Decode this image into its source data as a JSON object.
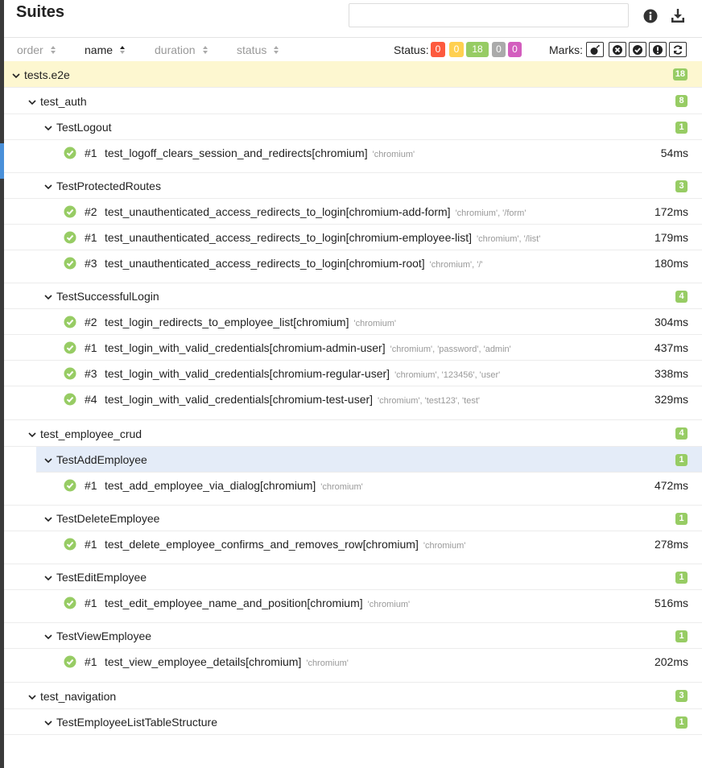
{
  "header": {
    "title": "Suites",
    "search_value": "",
    "search_placeholder": "",
    "info_icon": "info-circle-icon",
    "download_icon": "download-icon"
  },
  "sortbar": {
    "columns": [
      "order",
      "name",
      "duration",
      "status"
    ],
    "active_column": "name",
    "status_label": "Status:",
    "status_counts": [
      {
        "label": "0",
        "color": "#fd5a3e"
      },
      {
        "label": "0",
        "color": "#ffd050"
      },
      {
        "label": "18",
        "color": "#97cc64"
      },
      {
        "label": "0",
        "color": "#aaaaaa"
      },
      {
        "label": "0",
        "color": "#d35ebe"
      }
    ],
    "marks_label": "Marks:",
    "marks": [
      "bomb-icon",
      "times-circle-icon",
      "check-circle-icon",
      "exclamation-circle-icon",
      "refresh-icon"
    ]
  },
  "tree": {
    "root": {
      "name": "tests.e2e",
      "count": "18"
    },
    "modules": [
      {
        "name": "test_auth",
        "count": "8",
        "classes": [
          {
            "name": "TestLogout",
            "count": "1",
            "tests": [
              {
                "order": "#1",
                "name": "test_logoff_clears_session_and_redirects[chromium]",
                "params": "'chromium'",
                "duration": "54ms"
              }
            ]
          },
          {
            "name": "TestProtectedRoutes",
            "count": "3",
            "tests": [
              {
                "order": "#2",
                "name": "test_unauthenticated_access_redirects_to_login[chromium-add-form]",
                "params": "'chromium', '/form'",
                "duration": "172ms"
              },
              {
                "order": "#1",
                "name": "test_unauthenticated_access_redirects_to_login[chromium-employee-list]",
                "params": "'chromium', '/list'",
                "duration": "179ms"
              },
              {
                "order": "#3",
                "name": "test_unauthenticated_access_redirects_to_login[chromium-root]",
                "params": "'chromium', '/'",
                "duration": "180ms"
              }
            ]
          },
          {
            "name": "TestSuccessfulLogin",
            "count": "4",
            "tests": [
              {
                "order": "#2",
                "name": "test_login_redirects_to_employee_list[chromium]",
                "params": "'chromium'",
                "duration": "304ms"
              },
              {
                "order": "#1",
                "name": "test_login_with_valid_credentials[chromium-admin-user]",
                "params": "'chromium', 'password', 'admin'",
                "duration": "437ms"
              },
              {
                "order": "#3",
                "name": "test_login_with_valid_credentials[chromium-regular-user]",
                "params": "'chromium', '123456', 'user'",
                "duration": "338ms"
              },
              {
                "order": "#4",
                "name": "test_login_with_valid_credentials[chromium-test-user]",
                "params": "'chromium', 'test123', 'test'",
                "duration": "329ms"
              }
            ]
          }
        ]
      },
      {
        "name": "test_employee_crud",
        "count": "4",
        "classes": [
          {
            "name": "TestAddEmployee",
            "count": "1",
            "selected": true,
            "tests": [
              {
                "order": "#1",
                "name": "test_add_employee_via_dialog[chromium]",
                "params": "'chromium'",
                "duration": "472ms"
              }
            ]
          },
          {
            "name": "TestDeleteEmployee",
            "count": "1",
            "tests": [
              {
                "order": "#1",
                "name": "test_delete_employee_confirms_and_removes_row[chromium]",
                "params": "'chromium'",
                "duration": "278ms"
              }
            ]
          },
          {
            "name": "TestEditEmployee",
            "count": "1",
            "tests": [
              {
                "order": "#1",
                "name": "test_edit_employee_name_and_position[chromium]",
                "params": "'chromium'",
                "duration": "516ms"
              }
            ]
          },
          {
            "name": "TestViewEmployee",
            "count": "1",
            "tests": [
              {
                "order": "#1",
                "name": "test_view_employee_details[chromium]",
                "params": "'chromium'",
                "duration": "202ms"
              }
            ]
          }
        ]
      },
      {
        "name": "test_navigation",
        "count": "3",
        "classes": [
          {
            "name": "TestEmployeeListTableStructure",
            "count": "1",
            "tests": []
          }
        ]
      }
    ]
  }
}
